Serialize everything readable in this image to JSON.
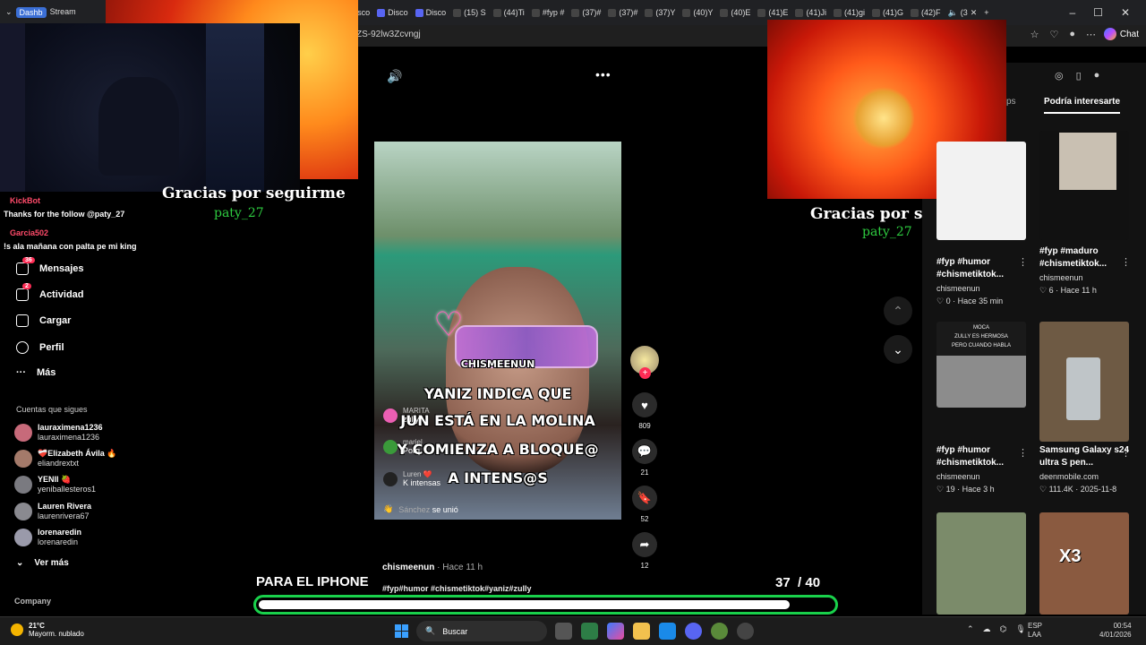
{
  "browser": {
    "tabs": [
      "Dashb",
      "Stream",
      "Disco",
      "Disco",
      "Disco",
      "(15) S",
      "(44)Ti",
      "#fyp #",
      "(37)#",
      "(37)#",
      "(37)Y",
      "(40)Y",
      "(40)E",
      "(41)E",
      "(41)Ji",
      "(41)gi",
      "(41)G",
      "(42)F",
      "(3"
    ],
    "url": "ZS-92lw3Zcvngj",
    "chat_label": "Chat"
  },
  "overlay": {
    "chat": [
      {
        "tag": "KickBot",
        "message": "Thanks for the follow @paty_27"
      },
      {
        "tag": "Garcia502",
        "message": "!s ala mañana con palta pe mi king"
      }
    ],
    "thanks_text": "Gracias por seguirme",
    "thanks_text_right": "Gracias por seguirme",
    "thanks_user": "paty_27",
    "progress_label": "PARA EL IPHONE",
    "progress_current": "37",
    "progress_total": "/ 40",
    "progress_fraction": 0.925
  },
  "sidebar": {
    "items": [
      {
        "label": "Mensajes",
        "badge": "36",
        "icon": "send-icon"
      },
      {
        "label": "Actividad",
        "badge": "2",
        "icon": "activity-icon"
      },
      {
        "label": "Cargar",
        "icon": "upload-icon"
      },
      {
        "label": "Perfil",
        "icon": "profile-icon"
      },
      {
        "label": "Más",
        "icon": "more-icon"
      }
    ],
    "following_title": "Cuentas que sigues",
    "following": [
      {
        "name": "lauraximena1236",
        "handle": "lauraximena1236"
      },
      {
        "name": "❤️‍🩹Elizabeth Ávila 🔥",
        "handle": "eliandrextxt"
      },
      {
        "name": "YENII 🍓",
        "handle": "yeniballesteros1"
      },
      {
        "name": "Lauren Rivera",
        "handle": "laurenrivera67"
      },
      {
        "name": "lorenaredin",
        "handle": "lorenaredin"
      }
    ],
    "see_more": "Ver más",
    "company": "Company"
  },
  "video": {
    "brand": "CHISMEENUN",
    "captions": [
      "YANIZ INDICA QUE",
      "JUN ESTÁ EN LA MOLINA",
      "Y COMIENZA A BLOQUE@",
      "A INTENS@S"
    ],
    "live_feed": [
      {
        "name": "MARITA",
        "text": "zully"
      },
      {
        "name": "mariel",
        "text": "Porq"
      },
      {
        "name": "Luren ❤️",
        "text": "K intensas"
      },
      {
        "name": "Sánchez",
        "text": "se unió"
      }
    ],
    "author": "chismeenun",
    "posted": "· Hace 11 h",
    "tags": "#fyp#humor #chismetiktok#yaniz#zully"
  },
  "actions": {
    "likes": "809",
    "comments": "21",
    "saves": "52",
    "shares": "12"
  },
  "right_panel": {
    "tab_a": "ps",
    "tab_b": "Podría interesarte",
    "cards": [
      {
        "title": "#fyp #humor #chismetiktok...",
        "author": "chismeenun",
        "stats": "♡ 0 · Hace 35 min"
      },
      {
        "title": "#fyp #maduro #chismetiktok...",
        "author": "chismeenun",
        "stats": "♡ 6 · Hace 11 h"
      },
      {
        "title": "#fyp #humor #chismetiktok...",
        "author": "chismeenun",
        "stats": "♡ 19 · Hace 3 h"
      },
      {
        "title": "Samsung Galaxy s24 ultra S pen...",
        "author": "deenmobile.com",
        "stats": "♡ 111.4K · 2025-11-8"
      }
    ],
    "card3_thumb_text": "MOCA\nZULLY ES HERMOSA\nPERO CUANDO HABLA",
    "card6_thumb_text": "X3"
  },
  "taskbar": {
    "temp": "21°C",
    "weather": "Mayorm. nublado",
    "search": "Buscar",
    "lang1": "ESP",
    "lang2": "LAA",
    "time": "00:54",
    "date": "4/01/2026"
  }
}
